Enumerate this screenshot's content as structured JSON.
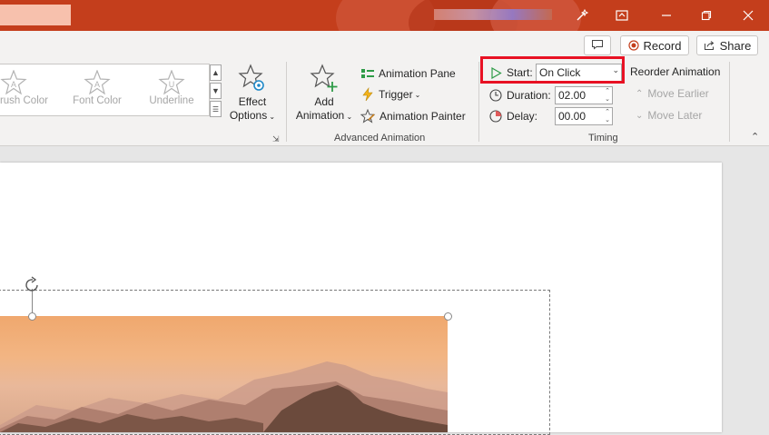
{
  "window": {
    "controls": {
      "designer": "wand-icon",
      "ribbon_display": "ribbon-display-icon",
      "minimize": "minimize-icon",
      "restore": "restore-icon",
      "close": "close-icon"
    },
    "accent_color": "#c43e1c"
  },
  "command_row": {
    "comments_icon": "comment-icon",
    "record_label": "Record",
    "share_label": "Share"
  },
  "ribbon": {
    "effects_gallery": {
      "items": [
        {
          "label": "Brush Color",
          "icon": "star-letter-a-icon"
        },
        {
          "label": "Font Color",
          "icon": "star-letter-a-icon"
        },
        {
          "label": "Underline",
          "icon": "star-letter-u-icon"
        }
      ],
      "label_first_visible": "rush Color"
    },
    "effect_options": {
      "label_line1": "Effect",
      "label_line2": "Options"
    },
    "advanced_animation": {
      "add_animation_line1": "Add",
      "add_animation_line2": "Animation",
      "animation_pane": "Animation Pane",
      "trigger": "Trigger",
      "animation_painter": "Animation Painter",
      "group_label": "Advanced Animation"
    },
    "timing": {
      "start_label": "Start:",
      "start_value": "On Click",
      "duration_label": "Duration:",
      "duration_value": "02.00",
      "delay_label": "Delay:",
      "delay_value": "00.00",
      "reorder_title": "Reorder Animation",
      "move_earlier": "Move Earlier",
      "move_later": "Move Later",
      "group_label": "Timing",
      "highlight_color": "#e81123"
    }
  }
}
